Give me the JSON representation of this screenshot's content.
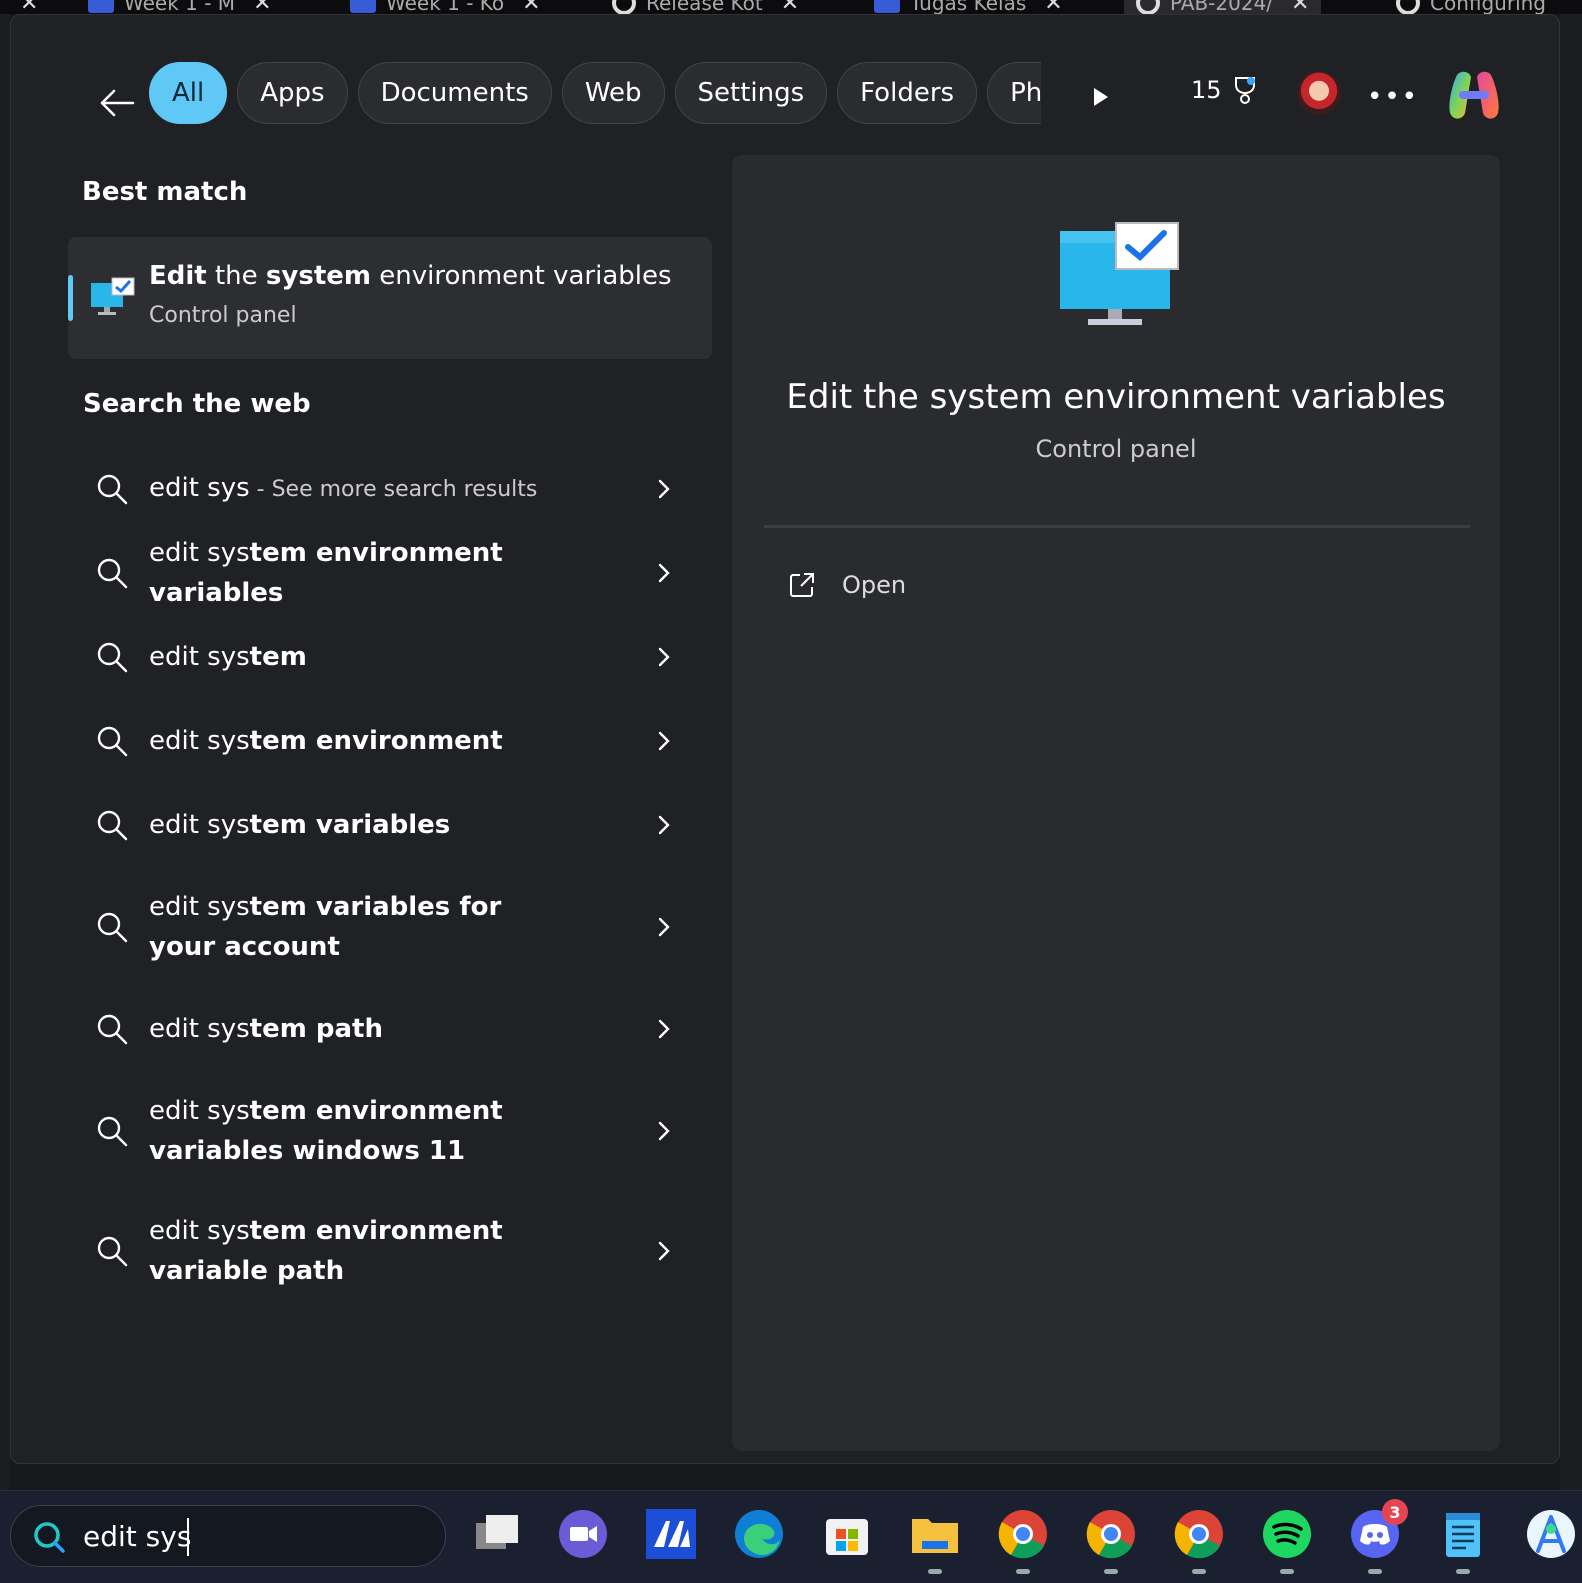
{
  "browser_tabs": [
    {
      "label": "Week 1 - M",
      "icon": "classroom-icon"
    },
    {
      "label": "Week 1 - Ko",
      "icon": "classroom-icon"
    },
    {
      "label": "Release Kot",
      "icon": "github-icon"
    },
    {
      "label": "Tugas Kelas",
      "icon": "classroom-icon"
    },
    {
      "label": "PAB-2024/",
      "icon": "github-icon"
    },
    {
      "label": "Configuring",
      "icon": "chatgpt-icon"
    }
  ],
  "filters": {
    "chips": [
      "All",
      "Apps",
      "Documents",
      "Web",
      "Settings",
      "Folders",
      "Pho"
    ],
    "active": "All"
  },
  "header": {
    "points": "15"
  },
  "best_match": {
    "section_title": "Best match",
    "title_bold_1": "Edit",
    "title_part_1": " the ",
    "title_bold_2": "system",
    "title_part_2": " environment variables",
    "subtitle": "Control panel"
  },
  "web": {
    "section_title": "Search the web",
    "items": [
      {
        "text": "edit sys",
        "hint": " - See more search results"
      },
      {
        "text_light": "edit sys",
        "text_bold": "tem environment variables"
      },
      {
        "text_light": "edit sys",
        "text_bold": "tem"
      },
      {
        "text_light": "edit sys",
        "text_bold": "tem environment"
      },
      {
        "text_light": "edit sys",
        "text_bold": "tem variables"
      },
      {
        "text_light": "edit sys",
        "text_bold": "tem variables for your account"
      },
      {
        "text_light": "edit sys",
        "text_bold": "tem path"
      },
      {
        "text_light": "edit sys",
        "text_bold": "tem environment variables windows 11"
      },
      {
        "text_light": "edit sys",
        "text_bold": "tem environment variable path"
      }
    ]
  },
  "preview": {
    "title": "Edit the system environment variables",
    "subtitle": "Control panel",
    "open_label": "Open"
  },
  "taskbar": {
    "search_value": "edit sys",
    "apps": [
      "task-view-icon",
      "teams-meet-icon",
      "mobaxterm-icon",
      "edge-icon",
      "store-icon",
      "file-explorer-icon",
      "chrome-icon",
      "chrome-icon",
      "chrome-icon",
      "spotify-icon",
      "discord-icon",
      "notepad-icon",
      "android-studio-icon"
    ],
    "discord_badge": "3"
  },
  "colors": {
    "accent": "#5fc8f5",
    "panel_bg": "#202124",
    "preview_bg": "#2a2b2e"
  }
}
